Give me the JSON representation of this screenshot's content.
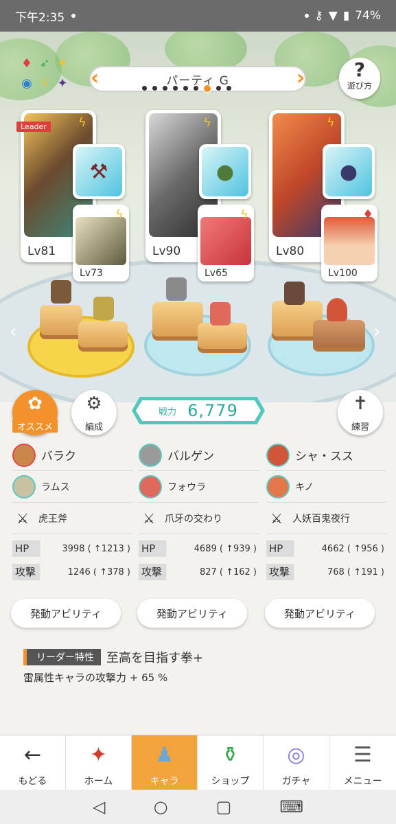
{
  "status_bar": {
    "time": "下午2:35",
    "battery": "74%"
  },
  "party": {
    "title": "パーティ G",
    "dots": 8,
    "active_dot": 6
  },
  "help": {
    "icon": "?",
    "label": "遊び方"
  },
  "leader_tag": "Leader",
  "cards": [
    {
      "main_lv": "Lv81",
      "sub_lv": "Lv73"
    },
    {
      "main_lv": "Lv90",
      "sub_lv": "Lv65"
    },
    {
      "main_lv": "Lv80",
      "sub_lv": "Lv100"
    }
  ],
  "buttons": {
    "osusume": "オススメ",
    "hensei": "編成",
    "renshu": "練習"
  },
  "power": {
    "label": "戦力",
    "value": "6,779"
  },
  "columns": [
    {
      "char": "バラク",
      "partner": "ラムス",
      "weapon": "虎王斧",
      "hp_label": "HP",
      "hp": "3998 ( ↑1213 )",
      "atk_label": "攻撃",
      "atk": "1246 ( ↑378 )",
      "ability": "発動アビリティ"
    },
    {
      "char": "バルゲン",
      "partner": "フォウラ",
      "weapon": "爪牙の交わり",
      "hp_label": "HP",
      "hp": "4689 ( ↑939 )",
      "atk_label": "攻撃",
      "atk": "827 ( ↑162 )",
      "ability": "発動アビリティ"
    },
    {
      "char": "シャ・スス",
      "partner": "キノ",
      "weapon": "人妖百鬼夜行",
      "hp_label": "HP",
      "hp": "4662 ( ↑956 )",
      "atk_label": "攻撃",
      "atk": "768 ( ↑191 )",
      "ability": "発動アビリティ"
    }
  ],
  "leader_skill": {
    "tag": "リーダー特性",
    "name": "至高を目指す拳+",
    "desc": "雷属性キャラの攻撃力 + 65 %"
  },
  "nav": [
    {
      "label": "もどる",
      "icon": "←"
    },
    {
      "label": "ホーム",
      "icon": "home-icon"
    },
    {
      "label": "キャラ",
      "icon": "chara-icon"
    },
    {
      "label": "ショップ",
      "icon": "shop-icon"
    },
    {
      "label": "ガチャ",
      "icon": "gacha-icon"
    },
    {
      "label": "メニュー",
      "icon": "menu-icon"
    }
  ]
}
